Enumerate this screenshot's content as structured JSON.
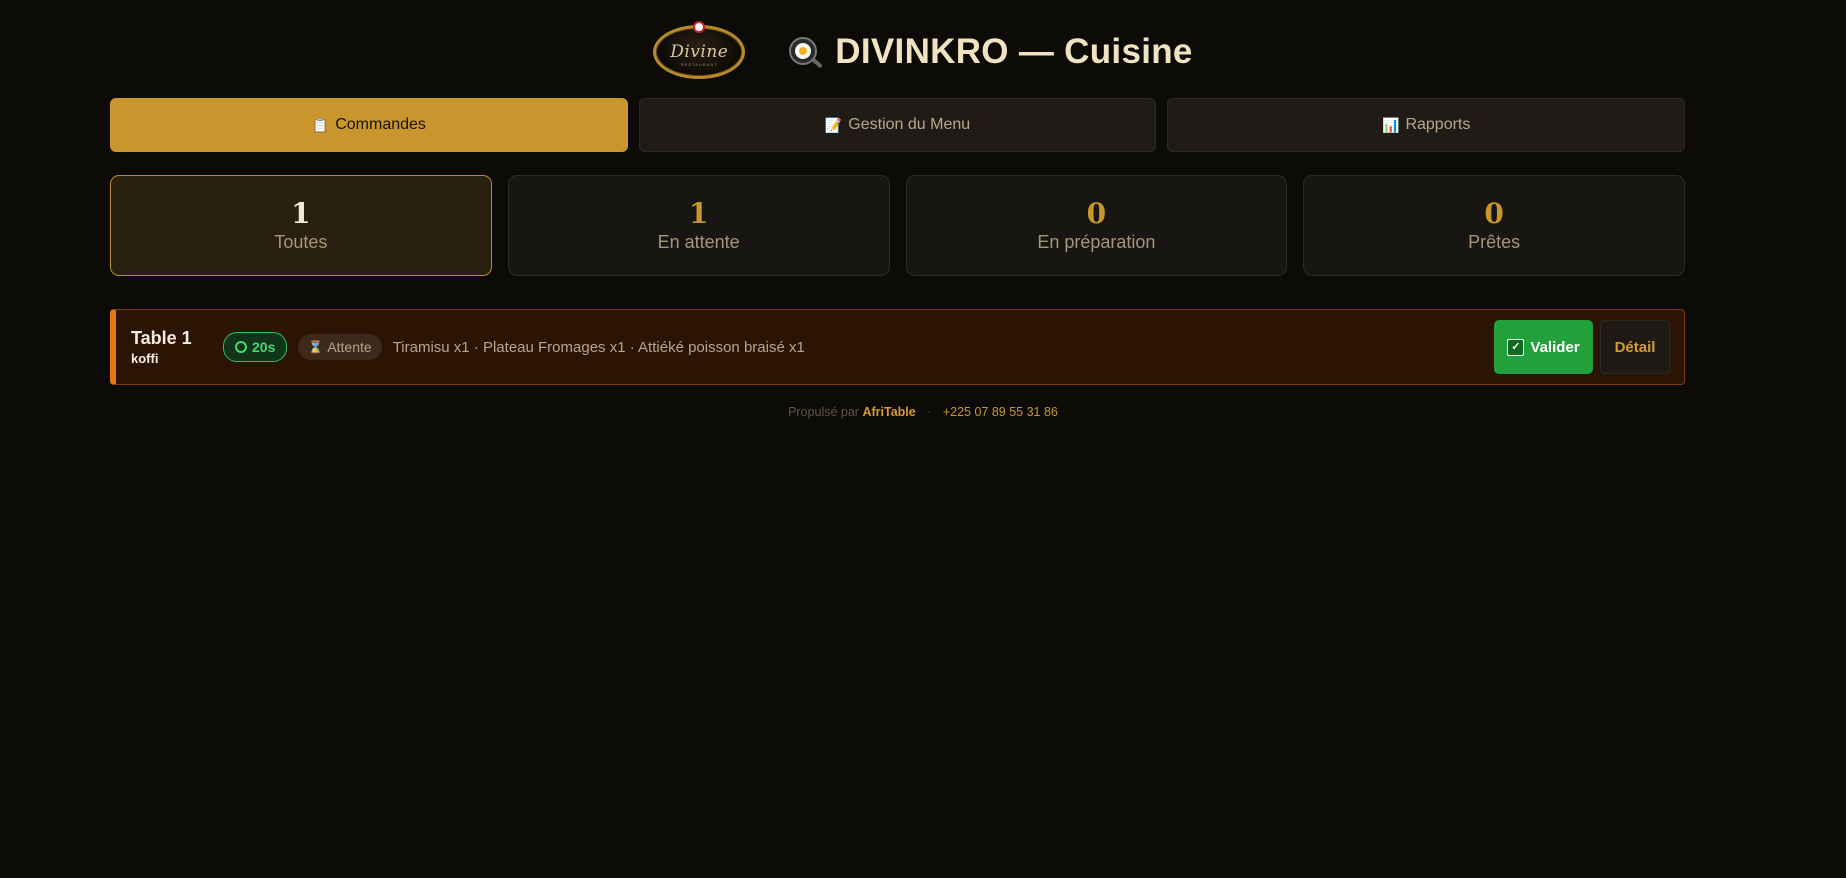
{
  "header": {
    "logo_text": "Divine",
    "logo_subtext": "RESTAURANT",
    "title_icon": "frying-pan-egg-icon",
    "title": "DIVINKRO — Cuisine"
  },
  "tabs": [
    {
      "icon": "📋",
      "label": "Commandes",
      "active": true
    },
    {
      "icon": "📝",
      "label": "Gestion du Menu",
      "active": false
    },
    {
      "icon": "📊",
      "label": "Rapports",
      "active": false
    }
  ],
  "stats": [
    {
      "value": "1",
      "label": "Toutes",
      "active": true
    },
    {
      "value": "1",
      "label": "En attente",
      "active": false
    },
    {
      "value": "0",
      "label": "En préparation",
      "active": false
    },
    {
      "value": "0",
      "label": "Prêtes",
      "active": false
    }
  ],
  "orders": [
    {
      "table": "Table 1",
      "waiter": "koffi",
      "timer": "20s",
      "status_icon": "⌛",
      "status": "Attente",
      "items": "Tiramisu x1 · Plateau Fromages x1 · Attiéké poisson braisé x1",
      "validate_label": "Valider",
      "detail_label": "Détail"
    }
  ],
  "footer": {
    "powered_by": "Propulsé par",
    "brand": "AfriTable",
    "separator": "·",
    "phone": "+225 07 89 55 31 86"
  },
  "colors": {
    "accent": "#c9962d",
    "background": "#0c0b08",
    "success": "#22a03c",
    "order_highlight": "#e0780f"
  }
}
